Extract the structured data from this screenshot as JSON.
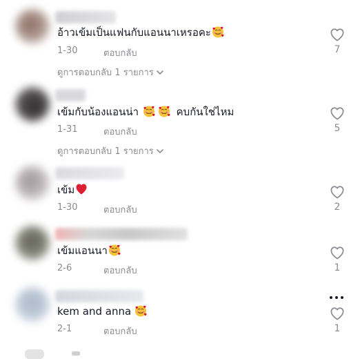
{
  "comments": [
    {
      "text": "อ้าวเข้มเป็นแฟนกับแอนนาเหรอคะ",
      "emoji": [
        "smiling-face-with-hearts"
      ],
      "date": "1-30",
      "reply_label": "ตอบกลับ",
      "likes": "7",
      "view_replies": "ดูการตอบกลับ 1 รายการ"
    },
    {
      "text": "เข้มกับน้องแอนน่า",
      "text_after": "คบกันใช่ไหม",
      "emoji": [
        "smiling-face-with-hearts",
        "smiling-face-with-hearts"
      ],
      "date": "1-31",
      "reply_label": "ตอบกลับ",
      "likes": "5",
      "view_replies": "ดูการตอบกลับ 1 รายการ"
    },
    {
      "text": "เข้ม",
      "emoji": [
        "red-heart"
      ],
      "date": "1-30",
      "reply_label": "ตอบกลับ",
      "likes": "2"
    },
    {
      "text": "เข้มแอนนา",
      "emoji": [
        "smiling-face-with-hearts"
      ],
      "date": "2-6",
      "reply_label": "ตอบกลับ",
      "likes": "1"
    },
    {
      "text": "kem and anna",
      "emoji": [
        "smiling-face-with-hearts"
      ],
      "date": "2-1",
      "reply_label": "ตอบกลับ",
      "likes": "1"
    }
  ],
  "icons": {
    "like": "heart-outline-icon",
    "more": "more-horizontal-icon",
    "chevron": "chevron-down-icon"
  },
  "colors": {
    "text": "#161823",
    "muted": "#8a8b91",
    "emoji_face": "#f7c23a",
    "emoji_heart": "#e0102b"
  }
}
